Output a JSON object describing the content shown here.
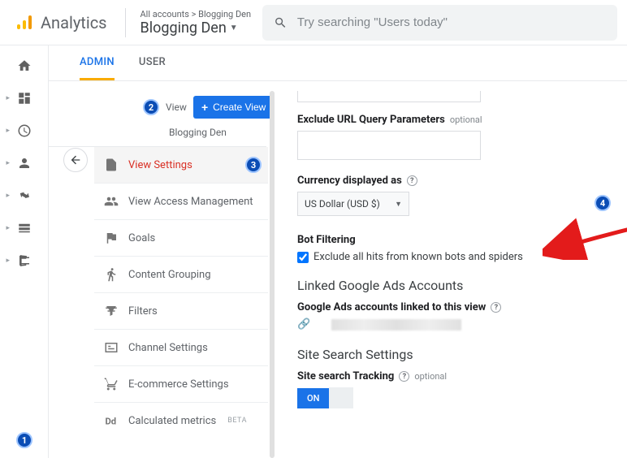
{
  "header": {
    "product": "Analytics",
    "breadcrumb": "All accounts > Blogging Den",
    "account_name": "Blogging Den",
    "search_placeholder": "Try searching \"Users today\""
  },
  "tabs": {
    "admin": "ADMIN",
    "user": "USER"
  },
  "view_column": {
    "label": "View",
    "create_btn": "Create View",
    "view_name": "Blogging Den",
    "menu": {
      "view_settings": "View Settings",
      "access": "View Access Management",
      "goals": "Goals",
      "content_grouping": "Content Grouping",
      "filters": "Filters",
      "channel": "Channel Settings",
      "ecommerce": "E-commerce Settings",
      "calc": "Calculated metrics",
      "beta": "BETA"
    }
  },
  "settings": {
    "exclude_params_label": "Exclude URL Query Parameters",
    "optional": "optional",
    "currency_label": "Currency displayed as",
    "currency_value": "US Dollar (USD $)",
    "bot_heading": "Bot Filtering",
    "bot_checkbox": "Exclude all hits from known bots and spiders",
    "linked_heading": "Linked Google Ads Accounts",
    "linked_sub": "Google Ads accounts linked to this view",
    "site_search_heading": "Site Search Settings",
    "site_search_sub": "Site search Tracking",
    "toggle_on": "ON"
  },
  "annotations": {
    "a1": "1",
    "a2": "2",
    "a3": "3",
    "a4": "4"
  }
}
